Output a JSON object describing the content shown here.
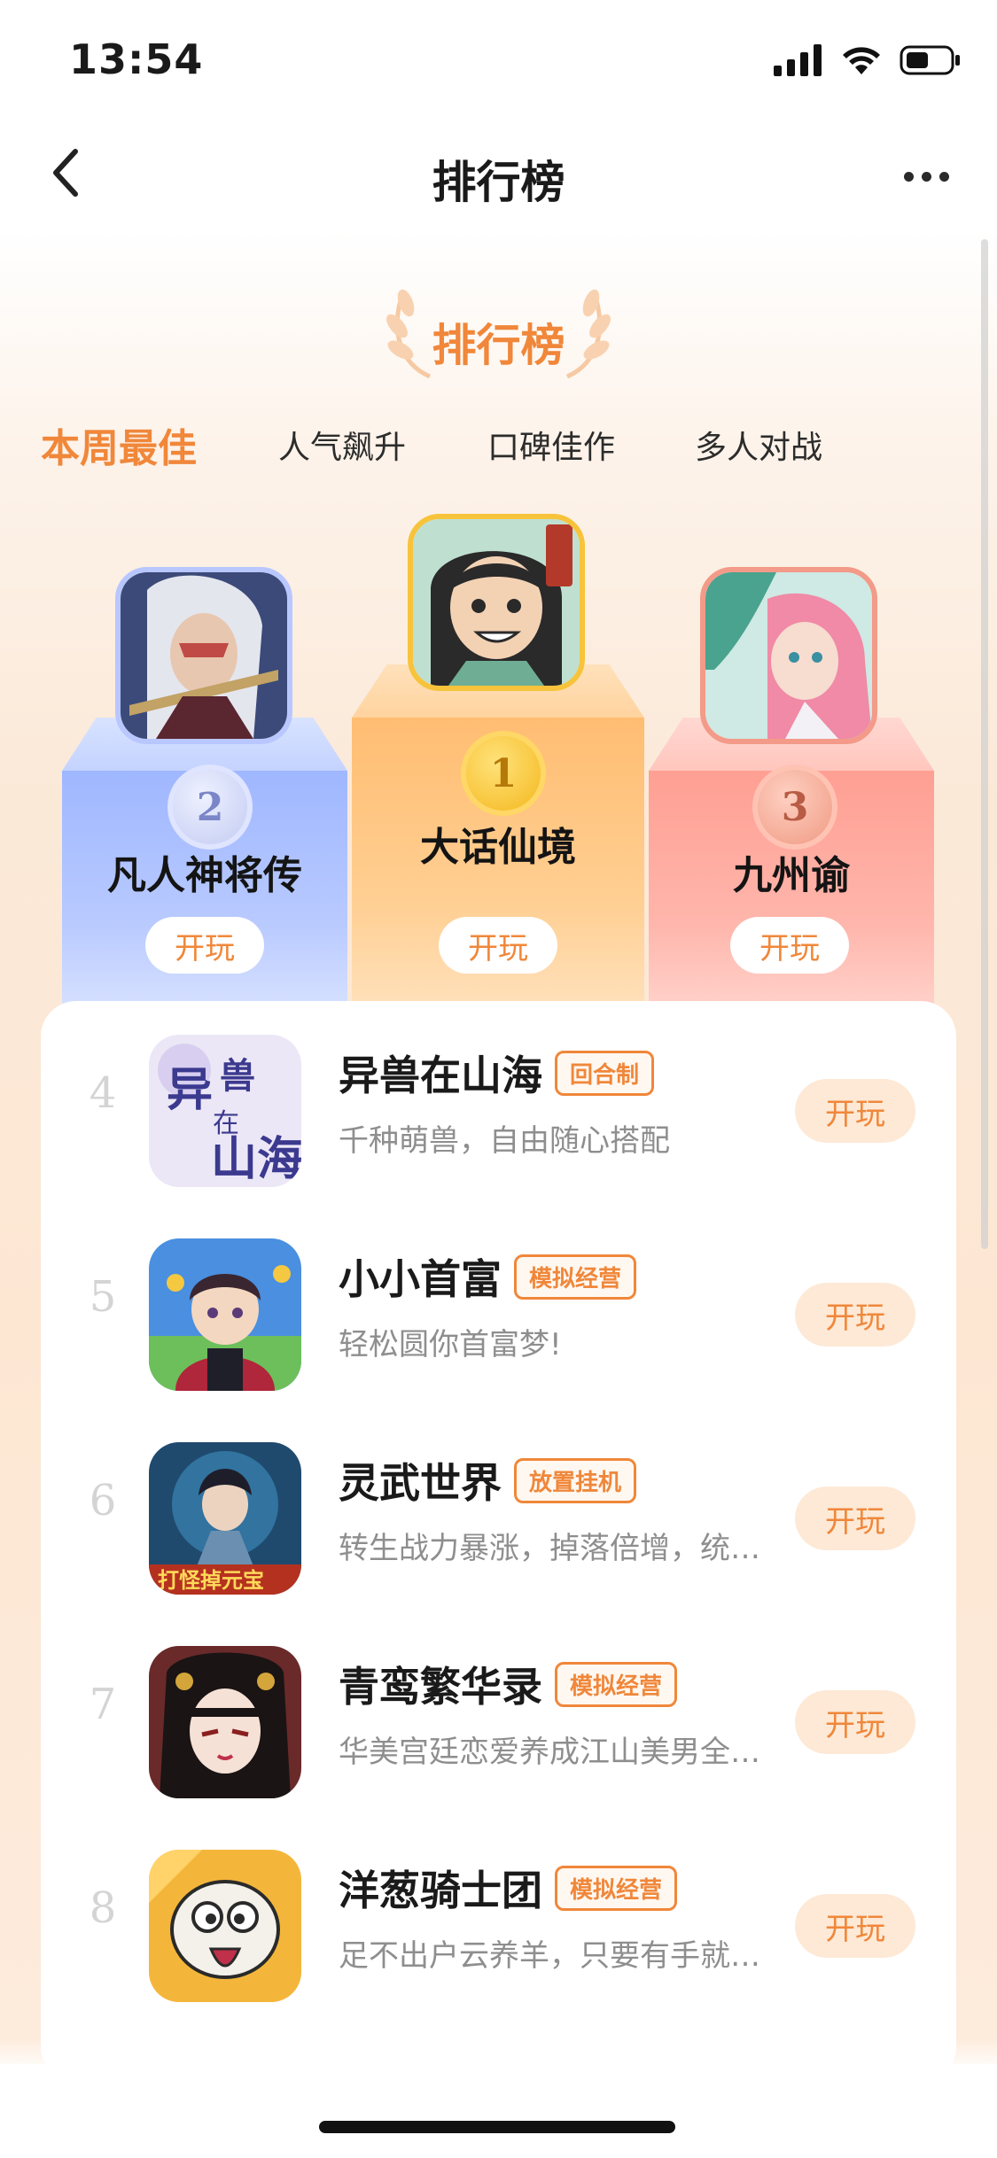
{
  "status_bar": {
    "time": "13:54"
  },
  "nav": {
    "title": "排行榜"
  },
  "rank_header": {
    "title": "排行榜"
  },
  "tabs": [
    {
      "label": "本周最佳",
      "active": true
    },
    {
      "label": "人气飙升",
      "active": false
    },
    {
      "label": "口碑佳作",
      "active": false
    },
    {
      "label": "多人对战",
      "active": false
    }
  ],
  "podium": {
    "first": {
      "rank": "1",
      "name": "大话仙境",
      "play": "开玩"
    },
    "second": {
      "rank": "2",
      "name": "凡人神将传",
      "play": "开玩"
    },
    "third": {
      "rank": "3",
      "name": "九州谕",
      "play": "开玩"
    }
  },
  "list": [
    {
      "rank": "4",
      "title": "异兽在山海",
      "tag": "回合制",
      "desc": "千种萌兽，自由随心搭配",
      "play": "开玩"
    },
    {
      "rank": "5",
      "title": "小小首富",
      "tag": "模拟经营",
      "desc": "轻松圆你首富梦!",
      "play": "开玩"
    },
    {
      "rank": "6",
      "title": "灵武世界",
      "tag": "放置挂机",
      "desc": "转生战力暴涨，掉落倍增，统…",
      "play": "开玩"
    },
    {
      "rank": "7",
      "title": "青鸾繁华录",
      "tag": "模拟经营",
      "desc": "华美宫廷恋爱养成江山美男全…",
      "play": "开玩"
    },
    {
      "rank": "8",
      "title": "洋葱骑士团",
      "tag": "模拟经营",
      "desc": "足不出户云养羊，只要有手就…",
      "play": "开玩"
    }
  ],
  "icons": {
    "back": "chevron-left-icon",
    "more": "more-horizontal-icon",
    "signal": "signal-icon",
    "wifi": "wifi-icon",
    "battery": "battery-icon",
    "laurel": "laurel-icon"
  },
  "colors": {
    "accent": "#f0873a",
    "first_pillar": "#ffbd72",
    "second_pillar": "#9fb7ff",
    "third_pillar": "#ff9f93",
    "play_button_bg": "#fde9d6"
  }
}
